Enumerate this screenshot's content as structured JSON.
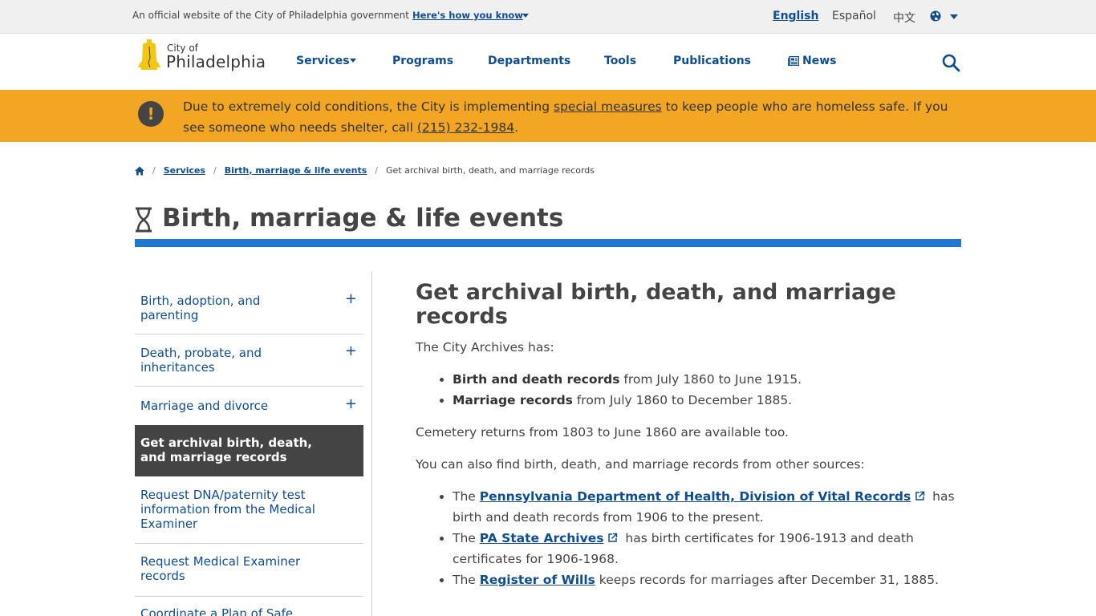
{
  "official_bar": {
    "text": "An official website of the City of Philadelphia government",
    "how_label": "Here's how you know",
    "languages": [
      "English",
      "Español",
      "中文"
    ]
  },
  "logo": {
    "line1": "City of",
    "line2": "Philadelphia"
  },
  "nav": {
    "services": "Services",
    "programs": "Programs",
    "departments": "Departments",
    "tools": "Tools",
    "publications": "Publications",
    "news": "News"
  },
  "alert": {
    "before": "Due to extremely cold conditions, the City is implementing ",
    "link1": "special measures",
    "middle": " to keep people who are homeless safe. If you see someone who needs shelter, call ",
    "phone": "(215) 232-1984",
    "after": "."
  },
  "breadcrumb": {
    "services": "Services",
    "section": "Birth, marriage & life events",
    "current": "Get archival birth, death, and marriage records"
  },
  "section_title": "Birth, marriage & life events",
  "sidenav": [
    "Birth, adoption, and parenting",
    "Death, probate, and inheritances",
    "Marriage and divorce",
    "Get archival birth, death, and marriage records",
    "Request DNA/paternity test information from the Medical Examiner",
    "Request Medical Examiner records",
    "Coordinate a Plan of Safe"
  ],
  "content": {
    "title": "Get archival birth, death, and marriage records",
    "intro": "The City Archives has:",
    "list1": [
      {
        "bold": "Birth and death records",
        "rest": " from July 1860 to June 1915."
      },
      {
        "bold": "Marriage records",
        "rest": " from July 1860 to December 1885."
      }
    ],
    "cemetery": "Cemetery returns from 1803 to June 1860 are available too.",
    "also": "You can also find birth, death, and marriage records from other sources:",
    "list2": [
      {
        "pre": "The ",
        "link": "Pennsylvania Department of Health, Division of Vital Records",
        "rest": " has birth and death records from 1906 to the present."
      },
      {
        "pre": "The ",
        "link": "PA State Archives",
        "rest": " has birth certificates for 1906-1913 and death certificates for 1906-1968."
      },
      {
        "pre": "The ",
        "link": "Register of Wills",
        "rest": " keeps records for marriages after December 31, 1885."
      }
    ]
  }
}
